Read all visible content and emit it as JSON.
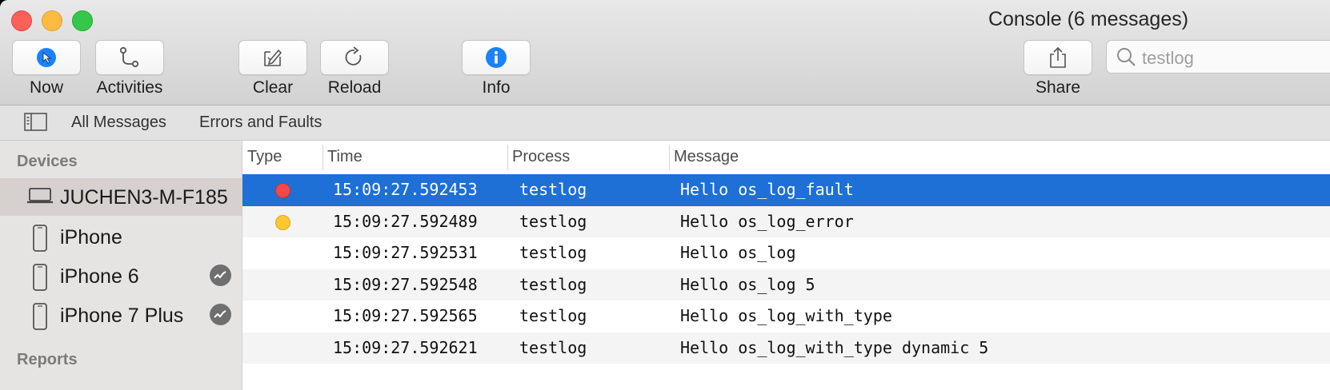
{
  "window": {
    "title": "Console (6 messages)"
  },
  "toolbar": {
    "buttons": [
      {
        "label": "Now",
        "icon": "now-arrow-icon"
      },
      {
        "label": "Activities",
        "icon": "activities-icon"
      },
      {
        "label": "Clear",
        "icon": "clear-icon"
      },
      {
        "label": "Reload",
        "icon": "reload-icon"
      },
      {
        "label": "Info",
        "icon": "info-icon"
      },
      {
        "label": "Share",
        "icon": "share-icon"
      }
    ],
    "search": {
      "value": "testlog",
      "icon": "search-icon"
    }
  },
  "scope": {
    "items": [
      "All Messages",
      "Errors and Faults"
    ]
  },
  "sidebar": {
    "devices_heading": "Devices",
    "devices": [
      {
        "label": "JUCHEN3-M-F185",
        "icon": "laptop-icon",
        "selected": true
      },
      {
        "label": "iPhone",
        "icon": "iphone-icon"
      },
      {
        "label": "iPhone 6",
        "icon": "iphone-icon",
        "badge": "activity-badge-icon"
      },
      {
        "label": "iPhone 7 Plus",
        "icon": "iphone-icon",
        "badge": "activity-badge-icon"
      }
    ],
    "reports_heading": "Reports"
  },
  "table": {
    "columns": [
      "Type",
      "Time",
      "Process",
      "Message"
    ],
    "rows": [
      {
        "type": "fault",
        "time": "15:09:27.592453",
        "process": "testlog",
        "message": "Hello os_log_fault",
        "selected": true
      },
      {
        "type": "error",
        "time": "15:09:27.592489",
        "process": "testlog",
        "message": "Hello os_log_error"
      },
      {
        "type": "",
        "time": "15:09:27.592531",
        "process": "testlog",
        "message": "Hello os_log"
      },
      {
        "type": "",
        "time": "15:09:27.592548",
        "process": "testlog",
        "message": "Hello os_log 5"
      },
      {
        "type": "",
        "time": "15:09:27.592565",
        "process": "testlog",
        "message": "Hello os_log_with_type"
      },
      {
        "type": "",
        "time": "15:09:27.592621",
        "process": "testlog",
        "message": "Hello os_log_with_type dynamic 5"
      }
    ]
  },
  "colors": {
    "selection": "#1e6fd6",
    "fault_dot": "#f5474a",
    "error_dot": "#fdc82f",
    "accent": "#1a82fb"
  }
}
